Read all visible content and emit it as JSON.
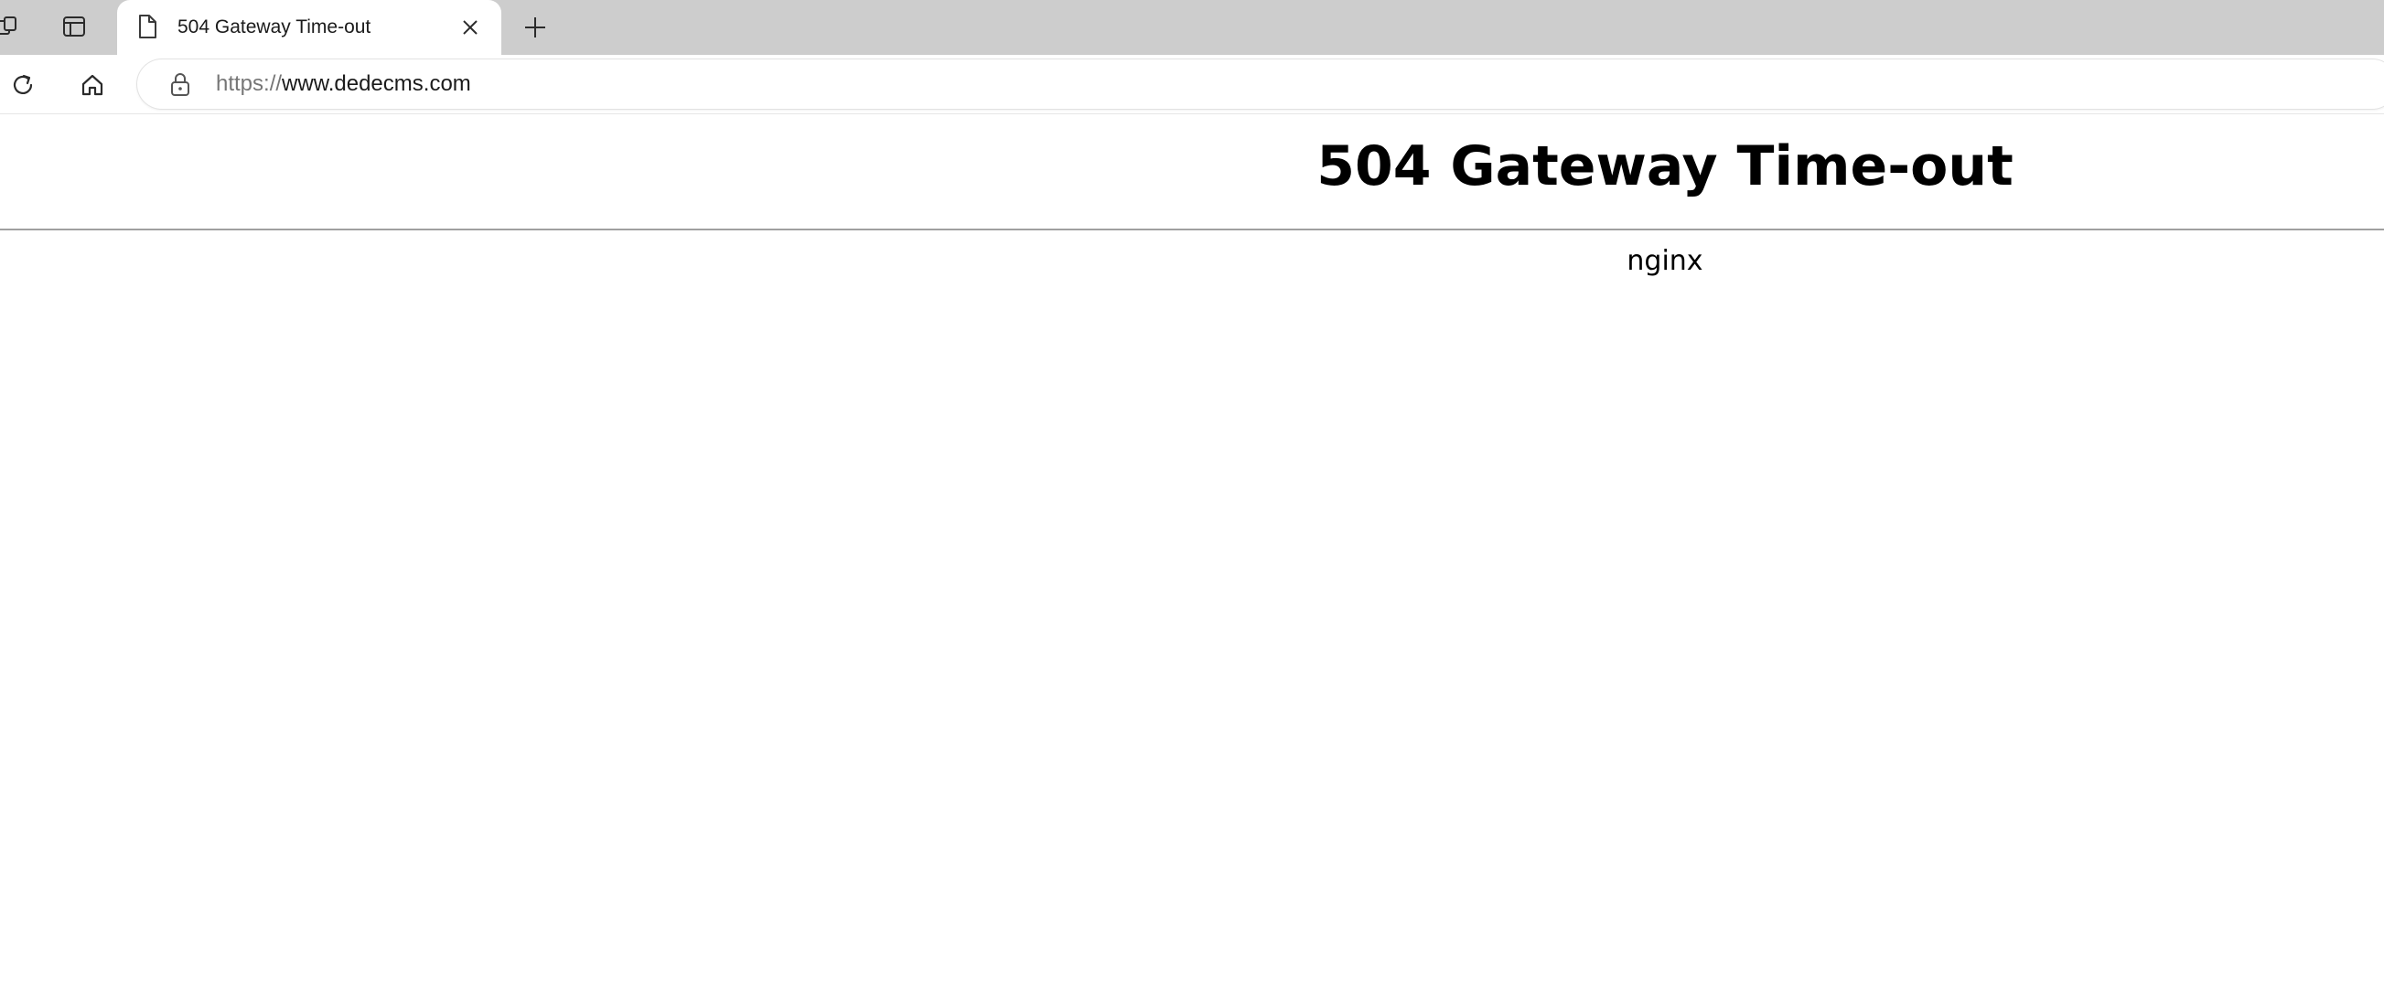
{
  "browser": {
    "tab": {
      "title": "504 Gateway Time-out",
      "favicon": "document-icon",
      "close": "close-icon"
    },
    "strip_icons": [
      "workspaces-icon",
      "vertical-tabs-icon"
    ],
    "new_tab_icon": "plus-icon",
    "toolbar": {
      "buttons": [
        "refresh-icon",
        "home-icon"
      ],
      "address": {
        "scheme": "https://",
        "host": "www.dedecms.com",
        "security_icon": "lock-icon"
      }
    },
    "colors": {
      "tabstrip": "#cdcdcd",
      "active_tab": "#ffffff",
      "url_scheme": "#767676",
      "url_host": "#1b1b1b"
    }
  },
  "page": {
    "heading": "504 Gateway Time-out",
    "server": "nginx",
    "colors": {
      "text": "#000000",
      "divider": "#a0a0a0",
      "background": "#ffffff"
    }
  }
}
